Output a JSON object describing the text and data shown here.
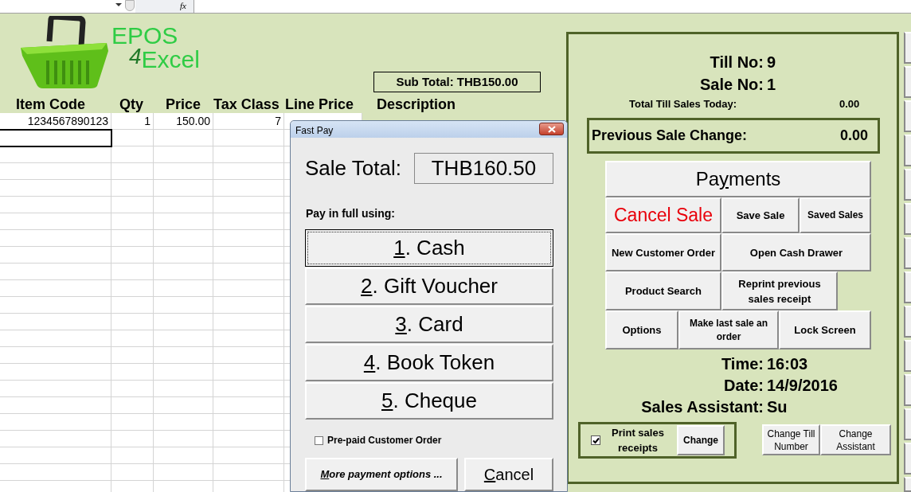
{
  "formula_bar": {
    "function_label": "fx"
  },
  "logo": {
    "line_1": "EPOS",
    "number": "4",
    "line_2": "Excel"
  },
  "sub_total": "Sub Total: THB150.00",
  "sheet": {
    "columns": [
      "Item Code",
      "Qty",
      "Price",
      "Tax Class",
      "Line Price",
      "Description"
    ],
    "rows": [
      {
        "cells": [
          "1234567890123",
          "1",
          "150.00",
          "7"
        ],
        "selected": false
      },
      {
        "cells": [],
        "selected": true
      }
    ]
  },
  "till": {
    "till_no_label": "Till No:",
    "till_no": "9",
    "sale_no_label": "Sale No:",
    "sale_no": "1",
    "total_label": "Total Till Sales Today:",
    "total": "0.00",
    "change_label": "Previous Sale Change:",
    "change": "0.00",
    "buttons": [
      {
        "label_start": "Pa",
        "access_key": "y",
        "label_end": "ments",
        "kind": "large"
      },
      {
        "label": "Cancel Sale",
        "kind": "cancel"
      },
      {
        "label": "Save Sale",
        "kind": "normal"
      },
      {
        "label": "Saved Sales",
        "kind": "small"
      },
      {
        "label": "New Customer Order",
        "kind": "normal"
      },
      {
        "label": "Open Cash Drawer",
        "kind": "normal"
      },
      {
        "label": "Product Search",
        "kind": "normal"
      },
      {
        "label": "Reprint previous sales receipt",
        "kind": "normal"
      },
      {
        "label": "Options",
        "kind": "normal"
      },
      {
        "label": "Make last sale an order",
        "kind": "small"
      },
      {
        "label": "Lock Screen",
        "kind": "normal"
      }
    ],
    "time_label": "Time:",
    "time": "16:03",
    "date_label": "Date:",
    "date": "14/9/2016",
    "assistant_label": "Sales Assistant:",
    "assistant": "Su",
    "print_receipts": {
      "label": "Print sales receipts",
      "checked": true,
      "button": "Change"
    },
    "change_till": "Change Till Number",
    "change_assistant": "Change Assistant"
  },
  "dialog": {
    "title": "Fast Pay",
    "sale_total_label": "Sale Total:",
    "sale_total": "THB160.50",
    "prompt": "Pay in full using:",
    "payment_buttons": [
      {
        "access_key": "1",
        "label_end": ". Cash",
        "focused": true
      },
      {
        "access_key": "2",
        "label_end": ". Gift Voucher",
        "focused": false
      },
      {
        "access_key": "3",
        "label_end": ". Card",
        "focused": false
      },
      {
        "access_key": "4",
        "label_end": ". Book Token",
        "focused": false
      },
      {
        "access_key": "5",
        "label_end": ". Cheque",
        "focused": false
      }
    ],
    "prepaid": {
      "label": "Pre-paid Customer Order",
      "checked": false
    },
    "more_button": {
      "access_key": "M",
      "label_end": "ore payment options ..."
    },
    "cancel_button": {
      "access_key": "C",
      "label_end": "ancel"
    }
  }
}
